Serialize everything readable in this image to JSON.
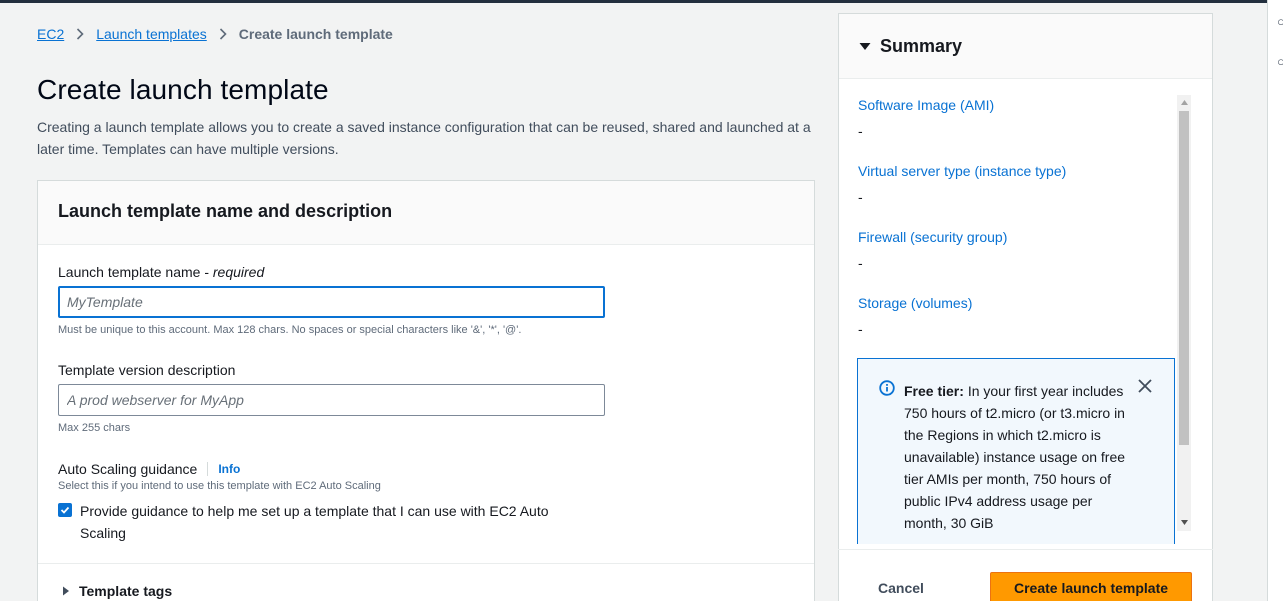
{
  "breadcrumb": {
    "items": [
      "EC2",
      "Launch templates"
    ],
    "current": "Create launch template"
  },
  "page": {
    "title": "Create launch template",
    "description": "Creating a launch template allows you to create a saved instance configuration that can be reused, shared and launched at a later time. Templates can have multiple versions."
  },
  "name_section": {
    "header": "Launch template name and description",
    "name_label": "Launch template name - ",
    "name_required": "required",
    "name_placeholder": "MyTemplate",
    "name_hint": "Must be unique to this account. Max 128 chars. No spaces or special characters like '&', '*', '@'.",
    "desc_label": "Template version description",
    "desc_placeholder": "A prod webserver for MyApp",
    "desc_hint": "Max 255 chars",
    "autoscaling_label": "Auto Scaling guidance",
    "autoscaling_info": "Info",
    "autoscaling_sub": "Select this if you intend to use this template with EC2 Auto Scaling",
    "autoscaling_checkbox_label": "Provide guidance to help me set up a template that I can use with EC2 Auto Scaling",
    "autoscaling_checked": true,
    "tags_label": "Template tags"
  },
  "summary": {
    "title": "Summary",
    "items": [
      {
        "label": "Software Image (AMI)",
        "value": "-"
      },
      {
        "label": "Virtual server type (instance type)",
        "value": "-"
      },
      {
        "label": "Firewall (security group)",
        "value": "-"
      },
      {
        "label": "Storage (volumes)",
        "value": "-"
      }
    ],
    "free_tier": {
      "title": "Free tier:",
      "body": "In your first year includes 750 hours of t2.micro (or t3.micro in the Regions in which t2.micro is unavailable) instance usage on free tier AMIs per month, 750 hours of public IPv4 address usage per month, 30 GiB"
    },
    "cancel_label": "Cancel",
    "create_label": "Create launch template"
  },
  "colors": {
    "link": "#0972d3",
    "primary_button": "#ff9900",
    "page_bg": "#f2f3f3"
  }
}
